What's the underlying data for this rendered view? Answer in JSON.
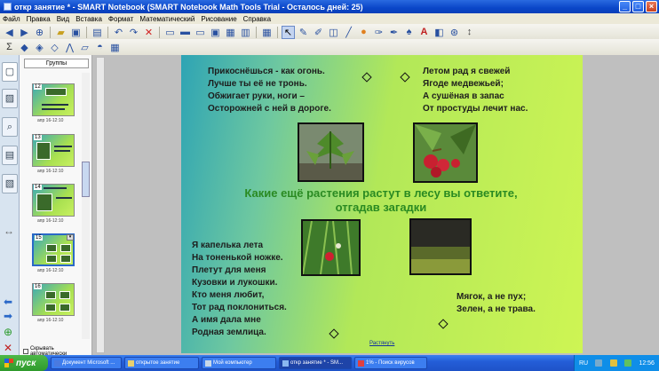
{
  "window": {
    "title": "откр занятие * - SMART Notebook (SMART Notebook Math Tools Trial - Осталось дней: 25)",
    "buttons": [
      "_",
      "□",
      "×"
    ]
  },
  "menu": [
    "Файл",
    "Правка",
    "Вид",
    "Вставка",
    "Формат",
    "Математический",
    "Рисование",
    "Справка"
  ],
  "sorter": {
    "groups_label": "Группы",
    "thumbs": [
      {
        "num": "12",
        "caption": "апр 16-12:10"
      },
      {
        "num": "13",
        "caption": "апр 16-12:10"
      },
      {
        "num": "14",
        "caption": "апр 16-12:10"
      },
      {
        "num": "15",
        "caption": "апр 16-12:10"
      },
      {
        "num": "16",
        "caption": "апр 16-12:10"
      }
    ],
    "autohide_label": "Скрывать автоматически"
  },
  "page": {
    "poem1": [
      "Прикоснёшься - как огонь.",
      "Лучше ты её не тронь.",
      "Обжигает руки, ноги –",
      "Осторожней с ней в дороге."
    ],
    "poem2": [
      "Летом рад я свежей",
      "Ягоде медвежьей;",
      "А сушёная в запас",
      "От простуды лечит нас."
    ],
    "headline_line1": "Какие ещё растения растут в лесу вы ответите,",
    "headline_line2": "отгадав загадки",
    "poem3": [
      "Я капелька лета",
      "На тоненькой ножке.",
      "Плетут для меня",
      "Кузовки и лукошки.",
      "Кто меня любит,",
      "Тот рад поклониться.",
      "А имя дала мне",
      "Родная землица."
    ],
    "poem4": [
      "Мягок, а не пух;",
      "Зелен, а не трава."
    ],
    "stretch_link": "Растянуть"
  },
  "taskbar": {
    "start": "пуск",
    "tasks": [
      {
        "label": "Документ Microsoft ...",
        "active": false
      },
      {
        "label": "открытое занятие",
        "active": false
      },
      {
        "label": "Мой компьютер",
        "active": false
      },
      {
        "label": "откр занятие * - SM...",
        "active": true
      },
      {
        "label": "1% - Поиск вирусов",
        "active": false
      }
    ],
    "lang": "RU",
    "clock": "12:56"
  }
}
